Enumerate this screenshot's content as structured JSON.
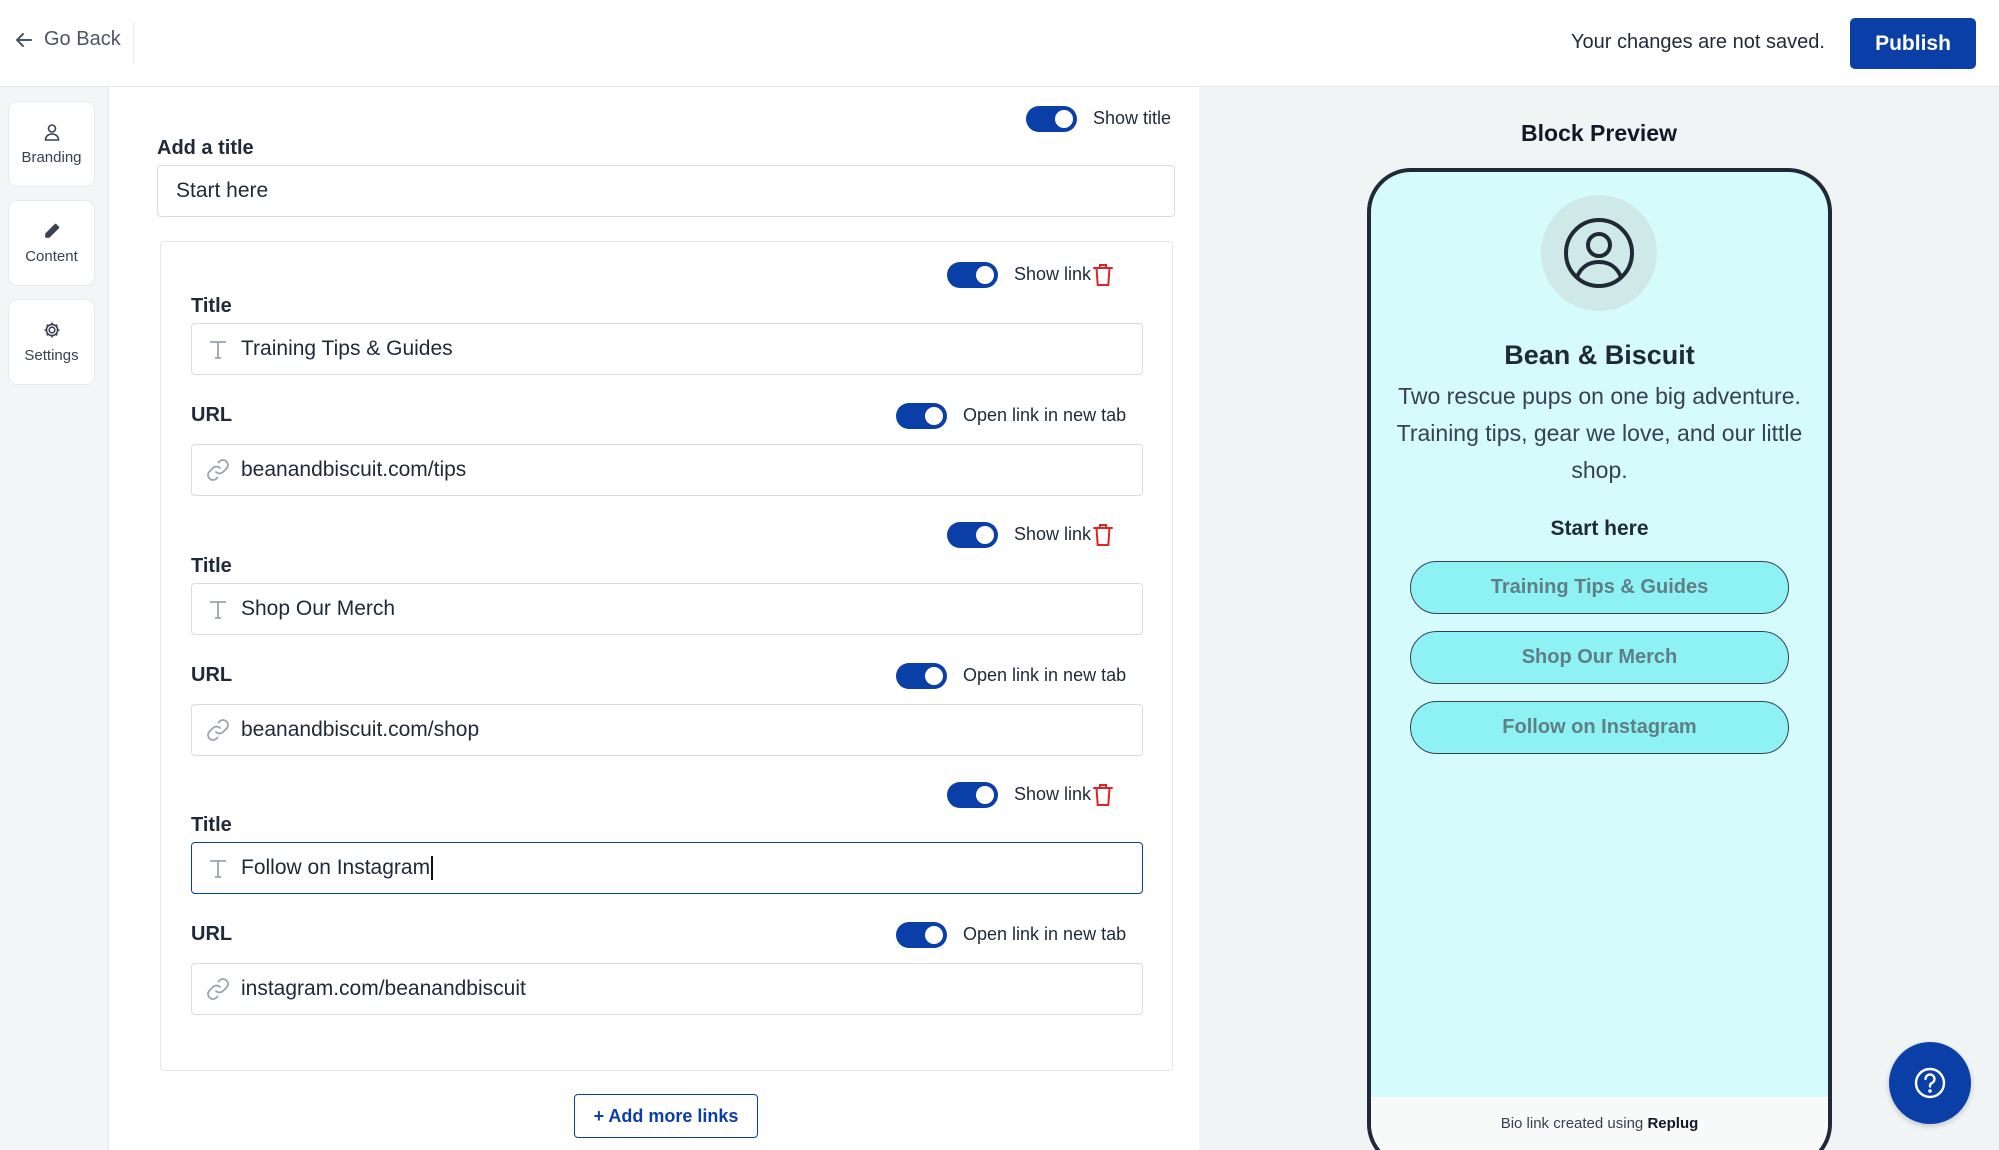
{
  "header": {
    "back_label": "Go Back",
    "unsaved_text": "Your changes are not saved.",
    "publish_label": "Publish"
  },
  "sidebar": {
    "items": [
      {
        "label": "Branding",
        "icon": "user-icon"
      },
      {
        "label": "Content",
        "icon": "pencil-icon"
      },
      {
        "label": "Settings",
        "icon": "gear-icon"
      }
    ]
  },
  "editor": {
    "show_title_label": "Show title",
    "show_title_on": true,
    "add_title_label": "Add a title",
    "title_value": "Start here",
    "links": [
      {
        "show_label": "Show link",
        "show_on": true,
        "title_label": "Title",
        "title_value": "Training Tips & Guides",
        "url_label": "URL",
        "new_tab_label": "Open link in new tab",
        "new_tab_on": true,
        "url_value": "beanandbiscuit.com/tips"
      },
      {
        "show_label": "Show link",
        "show_on": true,
        "title_label": "Title",
        "title_value": "Shop Our Merch",
        "url_label": "URL",
        "new_tab_label": "Open link in new tab",
        "new_tab_on": true,
        "url_value": "beanandbiscuit.com/shop"
      },
      {
        "show_label": "Show link",
        "show_on": true,
        "title_label": "Title",
        "title_value": "Follow on Instagram",
        "url_label": "URL",
        "new_tab_label": "Open link in new tab",
        "new_tab_on": true,
        "url_value": "instagram.com/beanandbiscuit"
      }
    ],
    "add_more_label": "+ Add more links"
  },
  "preview": {
    "heading": "Block Preview",
    "profile_name": "Bean & Biscuit",
    "bio": "Two rescue pups on one big adventure. Training tips, gear we love, and our little shop.",
    "block_title": "Start here",
    "links": [
      "Training Tips & Guides",
      "Shop Our Merch",
      "Follow on Instagram"
    ],
    "footer_prefix": "Bio link created using",
    "footer_brand": "Replug"
  },
  "colors": {
    "accent": "#0b3fa8",
    "trash": "#dc2626",
    "phone_bg": "#d6fbfc",
    "link_button_bg": "#8ef2f5"
  }
}
